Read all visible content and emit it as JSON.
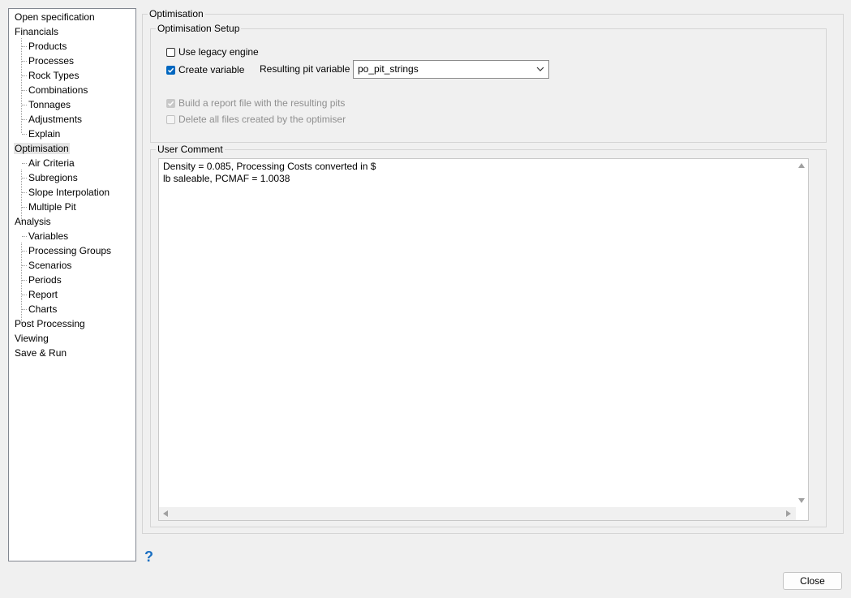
{
  "sidebar": {
    "items": [
      {
        "label": "Open specification",
        "level": 0
      },
      {
        "label": "Financials",
        "level": 0
      },
      {
        "label": "Products",
        "level": 1
      },
      {
        "label": "Processes",
        "level": 1
      },
      {
        "label": "Rock Types",
        "level": 1
      },
      {
        "label": "Combinations",
        "level": 1
      },
      {
        "label": "Tonnages",
        "level": 1
      },
      {
        "label": "Adjustments",
        "level": 1
      },
      {
        "label": "Explain",
        "level": 1
      },
      {
        "label": "Optimisation",
        "level": 0,
        "selected": true
      },
      {
        "label": "Air Criteria",
        "level": 1
      },
      {
        "label": "Subregions",
        "level": 1
      },
      {
        "label": "Slope Interpolation",
        "level": 1
      },
      {
        "label": "Multiple Pit",
        "level": 1
      },
      {
        "label": "Analysis",
        "level": 0
      },
      {
        "label": "Variables",
        "level": 1
      },
      {
        "label": "Processing Groups",
        "level": 1
      },
      {
        "label": "Scenarios",
        "level": 1
      },
      {
        "label": "Periods",
        "level": 1
      },
      {
        "label": "Report",
        "level": 1
      },
      {
        "label": "Charts",
        "level": 1
      },
      {
        "label": "Post Processing",
        "level": 0
      },
      {
        "label": "Viewing",
        "level": 0
      },
      {
        "label": "Save & Run",
        "level": 0
      }
    ]
  },
  "panel": {
    "title": "Optimisation",
    "setup": {
      "title": "Optimisation Setup",
      "use_legacy_engine": {
        "label": "Use legacy engine",
        "checked": false
      },
      "create_variable": {
        "label": "Create variable",
        "checked": true
      },
      "resulting_pit_variable_label": "Resulting pit variable",
      "resulting_pit_variable_value": "po_pit_strings",
      "build_report": {
        "label": "Build a report file with the resulting pits",
        "checked": true,
        "enabled": false
      },
      "delete_files": {
        "label": "Delete all files created by the optimiser",
        "checked": false,
        "enabled": false
      }
    },
    "comment": {
      "title": "User Comment",
      "text": "Density = 0.085, Processing Costs converted in $\nlb saleable, PCMAF = 1.0038"
    }
  },
  "footer": {
    "help_symbol": "?",
    "close_label": "Close"
  },
  "colors": {
    "accent": "#0067c0",
    "help": "#1a6fc2",
    "background": "#f0f0f0"
  }
}
